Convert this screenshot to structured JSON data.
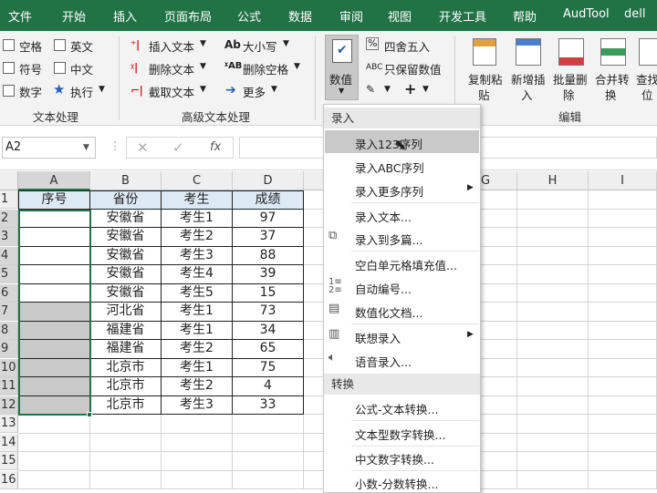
{
  "tabs": [
    "文件",
    "开始",
    "插入",
    "页面布局",
    "公式",
    "数据",
    "审阅",
    "视图",
    "开发工具",
    "帮助",
    "AudTool",
    "dell"
  ],
  "ribbon": {
    "text_group": {
      "items": [
        "空格",
        "英文",
        "符号",
        "中文",
        "数字",
        "执行"
      ],
      "label": "文本处理"
    },
    "advanced_group": {
      "items": [
        "插入文本",
        "删除文本",
        "截取文本",
        "大小写",
        "删除空格",
        "更多"
      ],
      "label": "高级文本处理"
    },
    "value_group": {
      "value_btn": "数值",
      "round": "四舍五入",
      "keep_value": "只保留数值"
    },
    "edit_group": {
      "buttons": [
        [
          "复制粘",
          "贴"
        ],
        [
          "新增插",
          "入"
        ],
        [
          "批量删",
          "除"
        ],
        [
          "合并转",
          "换"
        ],
        [
          "查找",
          "位"
        ]
      ],
      "label": "编辑"
    }
  },
  "formula_bar": {
    "name_box": "A2",
    "fx": "fx"
  },
  "columns": [
    "A",
    "B",
    "C",
    "D",
    "",
    "G",
    "H",
    "I"
  ],
  "rows": [
    "1",
    "2",
    "3",
    "4",
    "5",
    "6",
    "7",
    "8",
    "9",
    "10",
    "11",
    "12",
    "13",
    "14",
    "15",
    "16"
  ],
  "table": {
    "headers": [
      "序号",
      "省份",
      "考生",
      "成绩"
    ],
    "data": [
      [
        "",
        "安徽省",
        "考生1",
        "97"
      ],
      [
        "",
        "安徽省",
        "考生2",
        "37"
      ],
      [
        "",
        "安徽省",
        "考生3",
        "88"
      ],
      [
        "",
        "安徽省",
        "考生4",
        "39"
      ],
      [
        "",
        "安徽省",
        "考生5",
        "15"
      ],
      [
        "",
        "河北省",
        "考生1",
        "73"
      ],
      [
        "",
        "福建省",
        "考生1",
        "34"
      ],
      [
        "",
        "福建省",
        "考生2",
        "65"
      ],
      [
        "",
        "北京市",
        "考生1",
        "75"
      ],
      [
        "",
        "北京市",
        "考生2",
        "4"
      ],
      [
        "",
        "北京市",
        "考生3",
        "33"
      ]
    ]
  },
  "menu": {
    "section1": "录入",
    "items1": [
      "录入123序列",
      "录入ABC序列",
      "录入更多序列",
      "录入文本...",
      "录入到多篇...",
      "空白单元格填充值...",
      "自动编号...",
      "数值化文档...",
      "联想录入",
      "语音录入..."
    ],
    "section2": "转换",
    "items2": [
      "公式-文本转换...",
      "文本型数字转换...",
      "中文数字转换...",
      "小数-分数转换..."
    ]
  }
}
